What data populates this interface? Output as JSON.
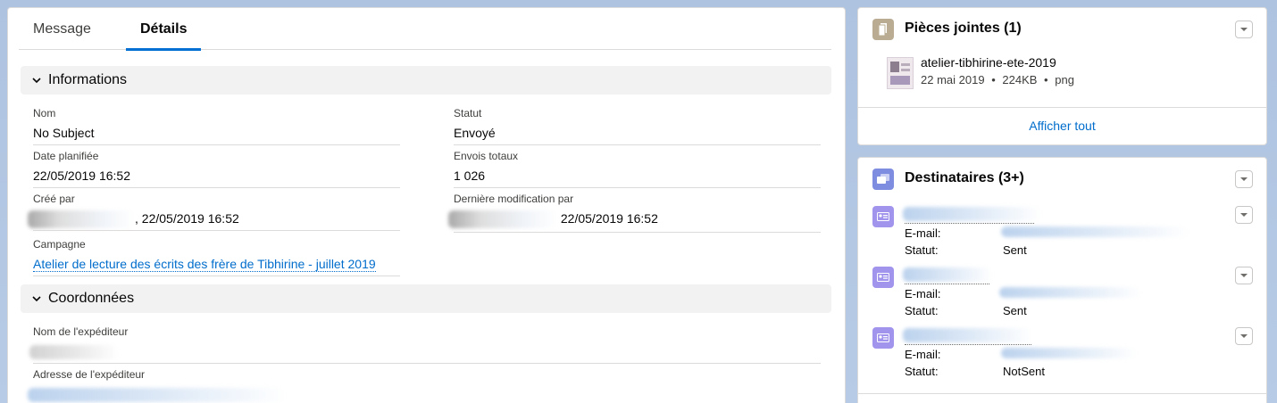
{
  "tabs": [
    {
      "label": "Message",
      "active": false
    },
    {
      "label": "Détails",
      "active": true
    }
  ],
  "sections": {
    "informations": "Informations",
    "coordonnees": "Coordonnées"
  },
  "fields": {
    "nom_label": "Nom",
    "nom_value": "No Subject",
    "statut_label": "Statut",
    "statut_value": "Envoyé",
    "date_label": "Date planifiée",
    "date_value": "22/05/2019 16:52",
    "envois_label": "Envois totaux",
    "envois_value": "1 026",
    "cree_label": "Créé par",
    "cree_value": ", 22/05/2019 16:52",
    "modif_label": "Dernière modification par",
    "modif_value": "22/05/2019 16:52",
    "campagne_label": "Campagne",
    "campagne_value": "Atelier de lecture des écrits des frère de Tibhirine - juillet 2019",
    "expediteur_nom_label": "Nom de l'expéditeur",
    "expediteur_adresse_label": "Adresse de l'expéditeur"
  },
  "attachments": {
    "title": "Pièces jointes (1)",
    "file_name": "atelier-tibhirine-ete-2019",
    "file_date": "22 mai 2019",
    "file_size": "224KB",
    "file_type": "png",
    "separator": "•",
    "view_all": "Afficher tout"
  },
  "recipients": {
    "title": "Destinataires (3+)",
    "email_label": "E-mail:",
    "status_label": "Statut:",
    "items": [
      {
        "status": "Sent"
      },
      {
        "status": "Sent"
      },
      {
        "status": "NotSent"
      }
    ]
  },
  "colors": {
    "accent": "#0070d2",
    "link": "#006dcc",
    "attachment_icon": "#baac93",
    "recipients_icon": "#7f8de1",
    "contact_icon": "#a094ed"
  }
}
